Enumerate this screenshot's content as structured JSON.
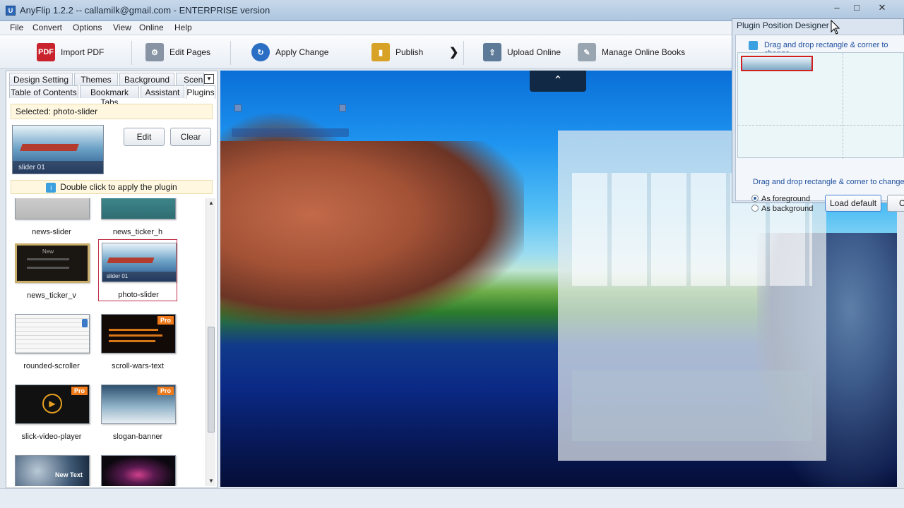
{
  "window": {
    "title": "AnyFlip 1.2.2  -- callamilk@gmail.com - ENTERPRISE version",
    "app_icon": "anyflip-logo-icon"
  },
  "menu": [
    "File",
    "Convert",
    "Options",
    "View",
    "Online",
    "Help"
  ],
  "toolbar": {
    "import_pdf": "Import PDF",
    "edit_pages": "Edit Pages",
    "apply_change": "Apply Change",
    "publish": "Publish",
    "upload_online": "Upload Online",
    "manage_online_books": "Manage Online Books"
  },
  "tabs": {
    "row1": [
      "Design Setting",
      "Themes",
      "Background",
      "Scene"
    ],
    "row2": [
      "Table of Contents",
      "Bookmark Tabs",
      "Assistant",
      "Plugins"
    ],
    "active": "Plugins"
  },
  "selected": "Selected: photo-slider",
  "buttons": {
    "edit": "Edit",
    "clear": "Clear"
  },
  "main_thumb_caption": "slider 01",
  "hint": "Double click to apply the plugin",
  "plugins": [
    {
      "label": "news-slider",
      "pro": false
    },
    {
      "label": "news_ticker_h",
      "pro": false
    },
    {
      "label": "news_ticker_v",
      "pro": false,
      "thumb_text": "New"
    },
    {
      "label": "photo-slider",
      "pro": false,
      "thumb_text": "slider 01",
      "selected": true
    },
    {
      "label": "rounded-scroller",
      "pro": false
    },
    {
      "label": "scroll-wars-text",
      "pro": true
    },
    {
      "label": "slick-video-player",
      "pro": true
    },
    {
      "label": "slogan-banner",
      "pro": true
    },
    {
      "label": "",
      "pro": false,
      "thumb_text": "New Text"
    },
    {
      "label": "",
      "pro": false
    }
  ],
  "pro_badge": "Pro",
  "designer": {
    "title": "Plugin Position Designer",
    "hint_top": "Drag and drop rectangle & corner to change",
    "hint_bottom": "Drag and drop rectangle & corner to change",
    "as_foreground": "As foreground",
    "as_background": "As background",
    "foreground_selected": true,
    "load_default": "Load default",
    "cut_button": "Cu"
  },
  "colors": {
    "accent": "#2b66b8",
    "selected_border": "#c0304a",
    "pro_badge": "#f07a1a",
    "hint_text": "#2050a0"
  }
}
